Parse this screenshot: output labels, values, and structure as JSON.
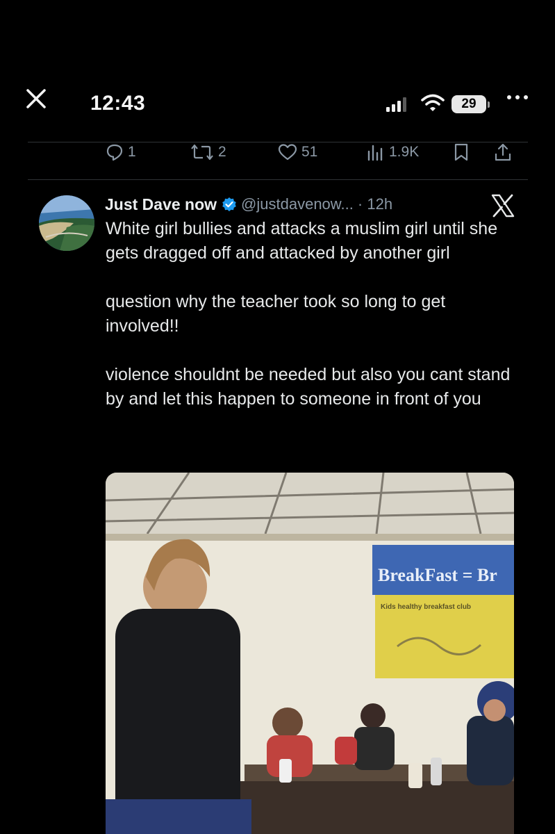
{
  "status_bar": {
    "time": "12:43",
    "battery": "29"
  },
  "prev_tweet_actions": {
    "replies": "1",
    "retweets": "2",
    "likes": "51",
    "views": "1.9K"
  },
  "tweet": {
    "display_name": "Just Dave now",
    "handle_time": "@justdavenow... · 12h",
    "paragraphs": [
      "White girl bullies and attacks a muslim girl until she gets dragged off and attacked by another girl",
      "question why the teacher took so long to get involved!!",
      "violence shouldnt be needed but also you cant stand by and let this happen to someone in front of you"
    ],
    "media": {
      "banner_text": "BreakFast = Br",
      "banner_subtext": "Kids healthy breakfast club"
    }
  },
  "colors": {
    "background": "#000000",
    "text_primary": "#e7e9ea",
    "text_secondary": "#8b98a5",
    "verified_blue": "#1d9bf0",
    "divider": "#2f3336"
  },
  "icons": {
    "close": "close-icon",
    "more": "more-icon",
    "reply": "reply-icon",
    "retweet": "retweet-icon",
    "like": "heart-icon",
    "views": "views-icon",
    "bookmark": "bookmark-icon",
    "share": "share-icon",
    "verified": "verified-badge-icon",
    "x_logo": "x-logo-icon"
  }
}
